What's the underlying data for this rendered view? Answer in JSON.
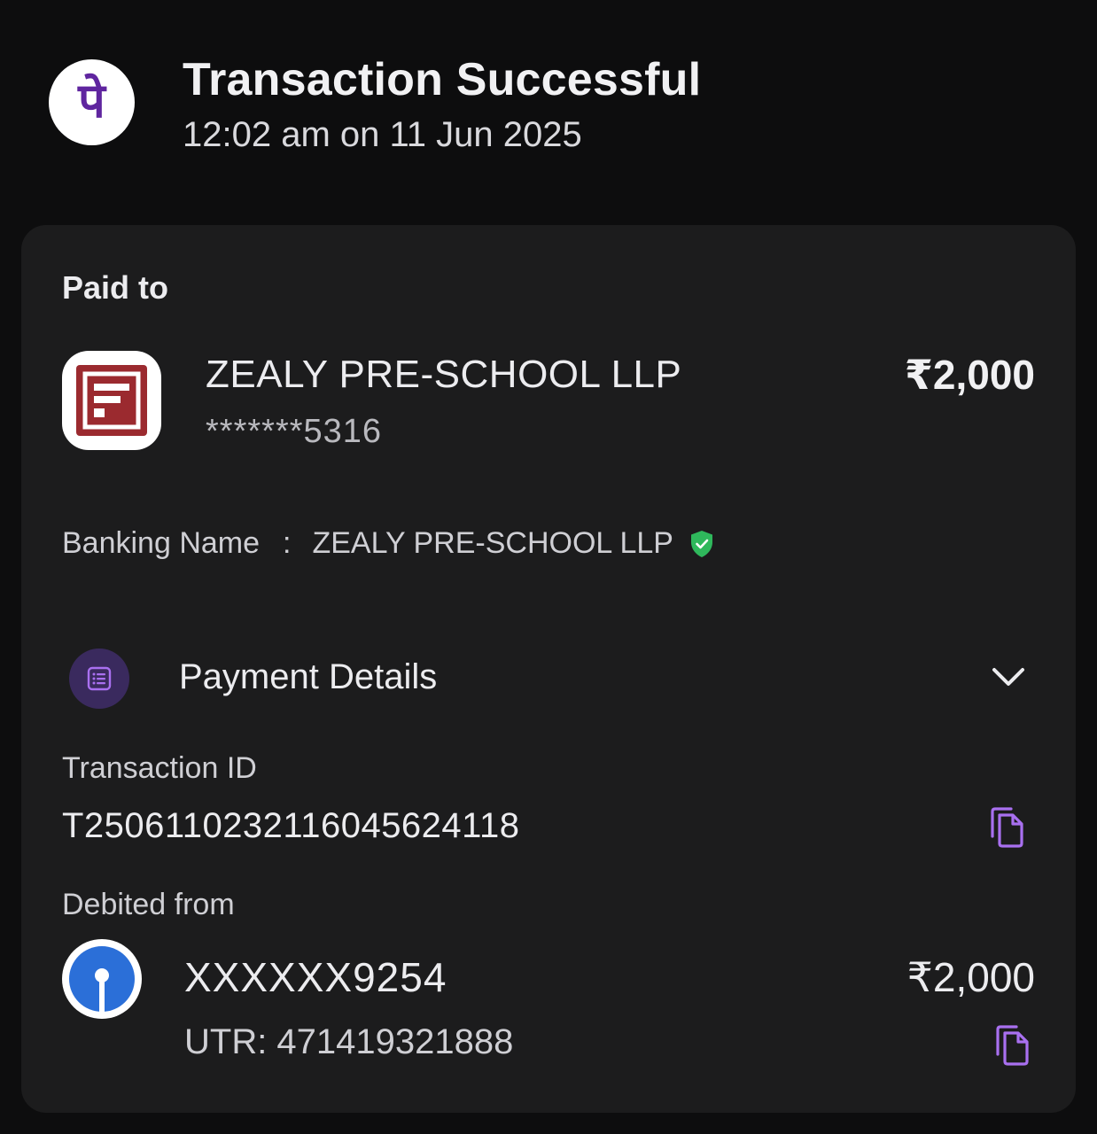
{
  "header": {
    "status_title": "Transaction Successful",
    "timestamp": "12:02 am on 11 Jun 2025",
    "app_logo_icon": "phonepe-logo-icon",
    "app_logo_glyph": "पे"
  },
  "paid_to": {
    "section_label": "Paid to",
    "merchant_name": "ZEALY PRE-SCHOOL LLP",
    "merchant_account": "*******5316",
    "amount": "₹2,000",
    "banking_name_label": "Banking Name",
    "banking_name_separator": ":",
    "banking_name_value": "ZEALY PRE-SCHOOL LLP",
    "verified_icon": "verified-shield-icon"
  },
  "payment_details": {
    "label": "Payment Details",
    "icon": "receipt-list-icon",
    "expand_icon": "chevron-down-icon"
  },
  "transaction": {
    "id_label": "Transaction ID",
    "id_value": "T2506110232116045624118"
  },
  "debited_from": {
    "label": "Debited from",
    "account": "XXXXXX9254",
    "amount": "₹2,000",
    "utr": "UTR: 471419321888",
    "bank_icon": "sbi-bank-logo-icon"
  },
  "colors": {
    "background": "#0d0d0e",
    "card": "#1c1c1d",
    "accent_purple": "#a970f0",
    "phonepe_purple": "#5f259f",
    "verified_green": "#2fb85c",
    "merchant_red": "#9b2a2f",
    "sbi_blue": "#2b6fd8"
  }
}
